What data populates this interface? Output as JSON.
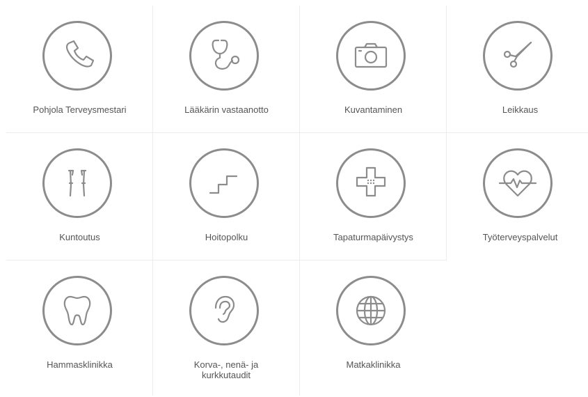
{
  "services": [
    {
      "label": "Pohjola Terveysmestari",
      "icon": "phone-icon"
    },
    {
      "label": "Lääkärin vastaanotto",
      "icon": "stethoscope-icon"
    },
    {
      "label": "Kuvantaminen",
      "icon": "camera-icon"
    },
    {
      "label": "Leikkaus",
      "icon": "scissors-icon"
    },
    {
      "label": "Kuntoutus",
      "icon": "crutches-icon"
    },
    {
      "label": "Hoitopolku",
      "icon": "stairs-icon"
    },
    {
      "label": "Tapaturmapäivystys",
      "icon": "bandage-cross-icon"
    },
    {
      "label": "Työterveyspalvelut",
      "icon": "heart-pulse-icon"
    },
    {
      "label": "Hammasklinikka",
      "icon": "tooth-icon"
    },
    {
      "label": "Korva-, nenä- ja kurkkutaudit",
      "icon": "ear-icon"
    },
    {
      "label": "Matkaklinikka",
      "icon": "globe-icon"
    }
  ],
  "colors": {
    "icon_stroke": "#8c8c8c",
    "label_text": "#555555",
    "grid_line": "#ececec"
  }
}
